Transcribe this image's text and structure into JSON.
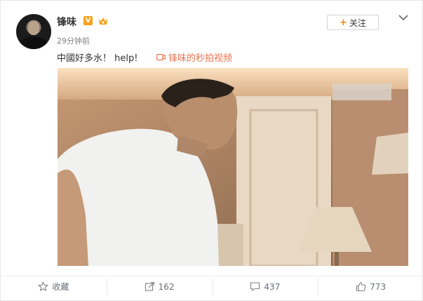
{
  "post": {
    "user_name": "锋味",
    "verified_badge": "V",
    "time": "29分钟前",
    "text": "中國好多水！ help!",
    "video_link_label": "锋味的秒拍视频",
    "follow_label": "关注",
    "follow_plus": "+"
  },
  "actions": [
    {
      "icon": "star-icon",
      "label": "收藏"
    },
    {
      "icon": "share-icon",
      "label": "162"
    },
    {
      "icon": "comment-icon",
      "label": "437"
    },
    {
      "icon": "like-icon",
      "label": "773"
    }
  ],
  "colors": {
    "accent_orange": "#ff8200",
    "link_orange": "#eb7350",
    "badge_gold": "#f7a21b",
    "text_gray": "#808080"
  }
}
